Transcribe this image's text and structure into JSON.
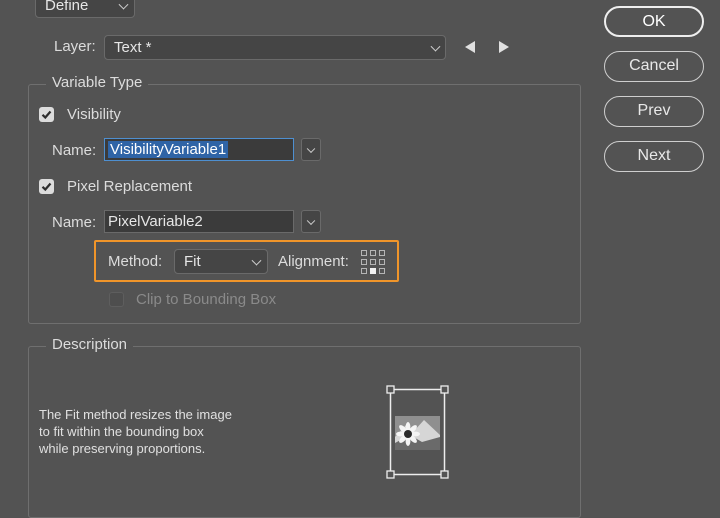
{
  "header": {
    "mode_select": "Define"
  },
  "layer": {
    "label": "Layer:",
    "value": "Text *"
  },
  "buttons": {
    "ok": "OK",
    "cancel": "Cancel",
    "prev": "Prev",
    "next": "Next"
  },
  "variable_type": {
    "legend": "Variable Type",
    "visibility": {
      "checkbox_label": "Visibility",
      "checked": true,
      "name_label": "Name:",
      "name_value": "VisibilityVariable1"
    },
    "pixel_replacement": {
      "checkbox_label": "Pixel Replacement",
      "checked": true,
      "name_label": "Name:",
      "name_value": "PixelVariable2",
      "method_label": "Method:",
      "method_value": "Fit",
      "alignment_label": "Alignment:",
      "clip_label": "Clip to Bounding Box",
      "clip_checked": false
    }
  },
  "description": {
    "legend": "Description",
    "lines": [
      "The Fit method resizes the image",
      "to fit within the bounding box",
      "while preserving proportions."
    ]
  },
  "icons": {
    "prev_layer": "triangle-left-icon",
    "next_layer": "triangle-right-icon",
    "alignment": "alignment-grid-icon",
    "preview": "fit-preview-icon"
  },
  "colors": {
    "highlight": "#f0952a",
    "focus": "#4e8fd0",
    "background": "#535353"
  }
}
